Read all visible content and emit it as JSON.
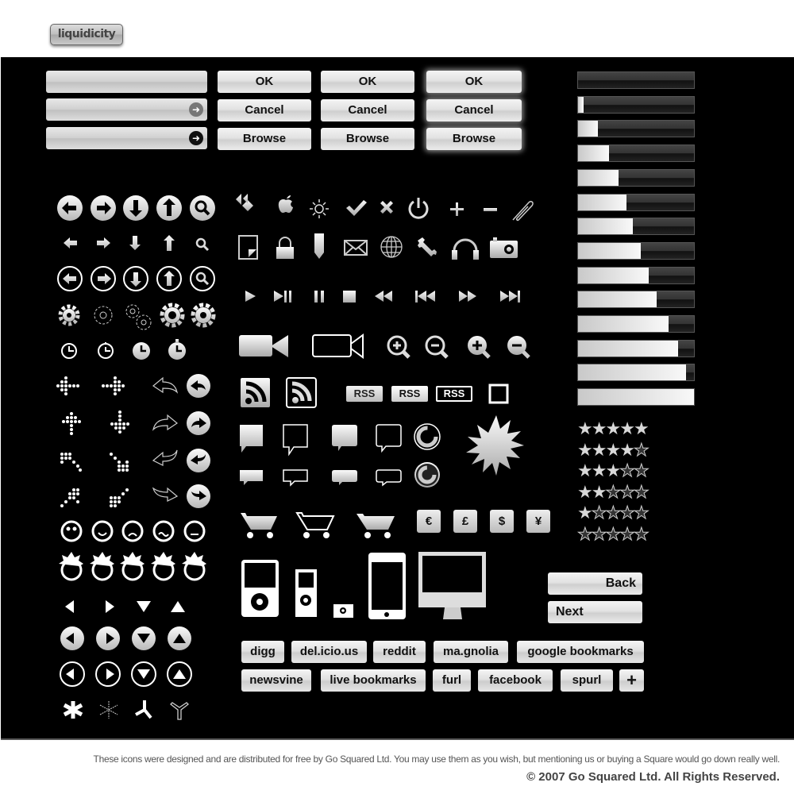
{
  "logo": {
    "label": "liquidicity"
  },
  "fields": [
    {
      "value": "",
      "icon": "none"
    },
    {
      "value": "",
      "icon": "arrow-right-grey-icon"
    },
    {
      "value": "",
      "icon": "arrow-right-black-icon"
    }
  ],
  "button_sets": [
    {
      "style": "plain",
      "buttons": [
        "OK",
        "Cancel",
        "Browse"
      ]
    },
    {
      "style": "bright",
      "buttons": [
        "OK",
        "Cancel",
        "Browse"
      ]
    },
    {
      "style": "glow",
      "buttons": [
        "OK",
        "Cancel",
        "Browse"
      ]
    }
  ],
  "progress_bars": [
    0,
    5,
    17,
    27,
    35,
    42,
    47,
    54,
    61,
    68,
    78,
    86,
    93,
    100
  ],
  "star_ratings": [
    5,
    4,
    3,
    2,
    1,
    0
  ],
  "star_max": 5,
  "glyphs": {
    "star": "★",
    "arrow": "➜",
    "plus": "+"
  },
  "rss_labels": [
    "RSS",
    "RSS",
    "RSS"
  ],
  "currency": [
    "€",
    "£",
    "$",
    "¥"
  ],
  "nav": {
    "back": "Back",
    "next": "Next"
  },
  "bookmarks_row1": [
    "digg",
    "del.icio.us",
    "reddit",
    "ma.gnolia",
    "google bookmarks"
  ],
  "bookmarks_row2": [
    "newsvine",
    "live bookmarks",
    "furl",
    "facebook",
    "spurl"
  ],
  "icons": {
    "left_column": [
      "arrow-left-circle",
      "arrow-right-circle",
      "arrow-down-circle",
      "arrow-up-circle",
      "search-circle",
      "arrow-left",
      "arrow-right",
      "arrow-down",
      "arrow-up",
      "search",
      "arrow-left-ring",
      "arrow-right-ring",
      "arrow-down-ring",
      "arrow-up-ring",
      "search-ring",
      "gear",
      "gear-outline",
      "gears",
      "gear-large",
      "gear-large-alt",
      "clock",
      "stopwatch",
      "clock-filled",
      "stopwatch-filled",
      "dots-arrow-left",
      "dots-arrow-right",
      "undo-outline",
      "undo-circle",
      "dots-arrow-up",
      "dots-arrow-down",
      "redo-outline",
      "redo-circle",
      "dots-arrow-up-left",
      "dots-arrow-down-right",
      "reply-outline",
      "reply-circle",
      "dots-arrow-down-left",
      "dots-arrow-up-right",
      "forward-outline",
      "forward-circle",
      "smiley-neutral",
      "smiley-happy",
      "smiley-sad",
      "smiley-confused",
      "smiley-blank",
      "punk-neutral",
      "punk-happy",
      "punk-sad",
      "punk-confused",
      "punk-blank",
      "triangle-left",
      "triangle-right",
      "triangle-down",
      "triangle-up",
      "triangle-left-circle",
      "triangle-right-circle",
      "triangle-down-circle",
      "triangle-up-circle",
      "triangle-left-ring",
      "triangle-right-ring",
      "triangle-down-ring",
      "triangle-up-ring",
      "asterisk",
      "asterisk-outline",
      "tripod",
      "tripod-outline"
    ],
    "middle": [
      "windows",
      "apple",
      "brightness",
      "check",
      "close",
      "power",
      "plus",
      "minus",
      "paperclip",
      "document",
      "lock",
      "pencil",
      "mail",
      "globe",
      "wrench",
      "headphones",
      "camera",
      "play",
      "play-pause",
      "pause",
      "stop",
      "rewind",
      "skip-back",
      "fast-forward",
      "skip-forward",
      "video-camera",
      "video-camera-outline",
      "zoom-in",
      "zoom-out",
      "zoom-in-filled",
      "zoom-out-filled",
      "rss-feed",
      "rss-feed-outline",
      "checkbox",
      "speech-bubble",
      "speech-bubble-outline",
      "speech-bubble-round",
      "speech-bubble-round-outline",
      "refresh",
      "starburst",
      "speech-small",
      "speech-small-outline",
      "speech-small-round",
      "speech-small-round-outline",
      "refresh-dark",
      "cart",
      "cart-outline",
      "cart-alt",
      "ipod-classic",
      "ipod-nano",
      "ipod-shuffle",
      "iphone",
      "imac"
    ]
  },
  "footer": {
    "notice": "These icons were designed and are distributed for free by Go Squared Ltd. You may use them as you wish, but mentioning us or buying a Square would go down really well.",
    "copyright": "© 2007 Go Squared Ltd. All Rights Reserved."
  }
}
